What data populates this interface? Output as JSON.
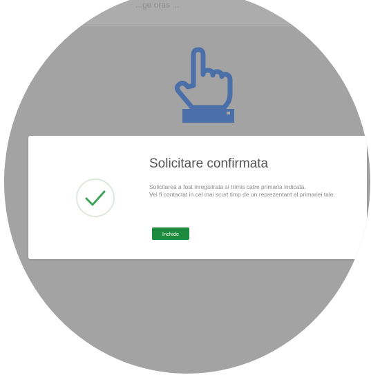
{
  "search": {
    "placeholder": "...ge oras ..."
  },
  "modal": {
    "title": "Solicitare confirmata",
    "message_line1": "Solicitarea a fost inregistrata si trimis catre primaria indicata.",
    "message_line2": "Vei fi contactat in cel mai scurt timp de un reprezentant al primariei tale.",
    "close_label": "Inchide"
  },
  "icons": {
    "hand": "pointing-hand-icon",
    "success": "checkmark-circle-icon"
  },
  "colors": {
    "backdrop": "#a3a3a3",
    "hand": "#4b6fa9",
    "accent_green": "#1e8a3e",
    "check_green": "#3ea45a"
  }
}
